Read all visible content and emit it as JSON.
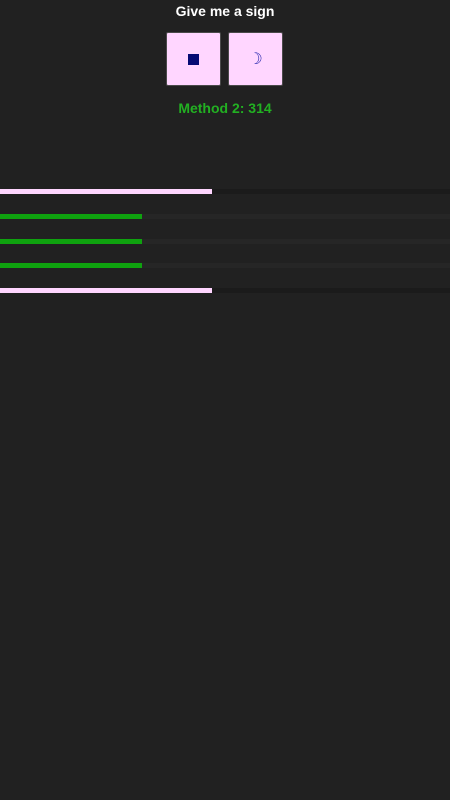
{
  "header": {
    "title": "Give me a sign"
  },
  "buttons": {
    "items": [
      {
        "icon": "square-icon",
        "label": "■"
      },
      {
        "icon": "crescent-moon-icon",
        "label": "☽"
      }
    ],
    "background": "#ffd6ff",
    "icon_color": "#060b74"
  },
  "method": {
    "label": "Method 2: 314",
    "color": "#22b022"
  },
  "bars": [
    {
      "color": "#ffd6ff",
      "progress": 0.47
    },
    {
      "color": "#0fa20f",
      "progress": 0.316
    },
    {
      "color": "#0fa20f",
      "progress": 0.316
    },
    {
      "color": "#0fa20f",
      "progress": 0.316
    },
    {
      "color": "#ffd6ff",
      "progress": 0.47
    }
  ]
}
